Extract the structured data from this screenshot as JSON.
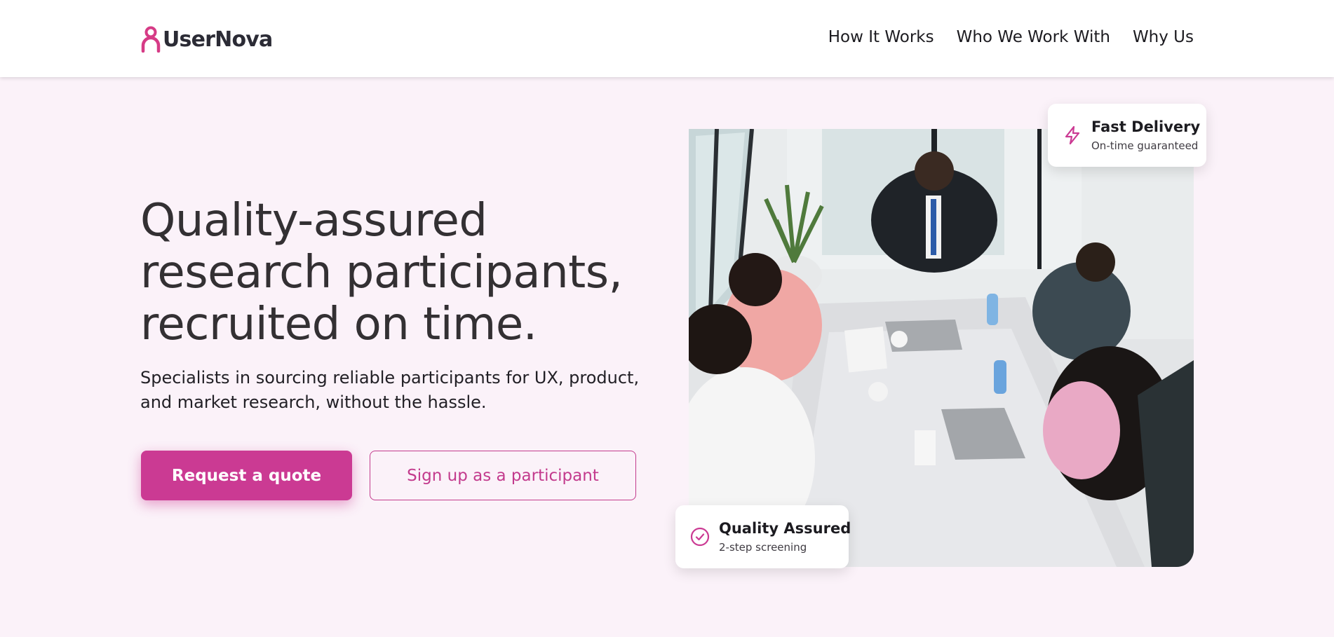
{
  "brand": {
    "name": "UserNova",
    "accent": "#cb3a93",
    "background": "#fbf2f9"
  },
  "nav": {
    "items": [
      {
        "label": "How It Works"
      },
      {
        "label": "Who We Work With"
      },
      {
        "label": "Why Us"
      }
    ]
  },
  "hero": {
    "title": "Quality-assured research participants, recruited on time.",
    "subtitle": "Specialists in sourcing reliable participants for UX, product, and market research, without the hassle.",
    "primary_cta": "Request a quote",
    "secondary_cta": "Sign up as a participant",
    "photo_icon": "team-meeting-photo"
  },
  "badges": {
    "fast_delivery": {
      "icon": "lightning-icon",
      "title": "Fast Delivery",
      "subtitle": "On-time guaranteed"
    },
    "quality_assured": {
      "icon": "check-circle-icon",
      "title": "Quality Assured",
      "subtitle": "2-step screening"
    }
  }
}
